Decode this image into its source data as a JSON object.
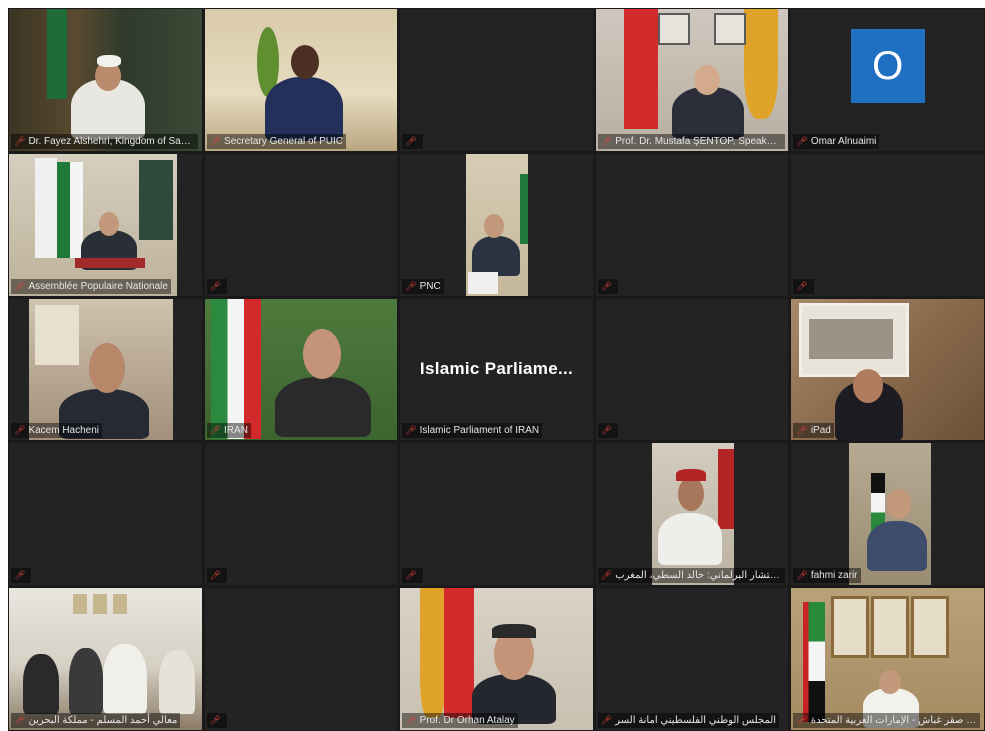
{
  "meeting": {
    "participants": [
      {
        "name": "Dr. Fayez Alshehri, Kingdom of Saudi Ar...",
        "video": true
      },
      {
        "name": "Secretary General of PUIC",
        "video": true,
        "active": true
      },
      {
        "name": "",
        "video": false
      },
      {
        "name": "Prof. Dr. Mustafa ŞENTOP, Speaker of th...",
        "video": true
      },
      {
        "name": "Omar Alnuaimi",
        "video": false,
        "avatar_letter": "O"
      },
      {
        "name": "Assemblée Populaire Nationale",
        "video": true
      },
      {
        "name": "",
        "video": false
      },
      {
        "name": "PNC",
        "video": true
      },
      {
        "name": "",
        "video": false
      },
      {
        "name": "",
        "video": false
      },
      {
        "name": "Kacem Hacheni",
        "video": true
      },
      {
        "name": "IRAN",
        "video": true
      },
      {
        "name": "Islamic Parliament of IRAN",
        "video": false,
        "center_label": "Islamic  Parliame..."
      },
      {
        "name": "",
        "video": false
      },
      {
        "name": "iPad",
        "video": true
      },
      {
        "name": "",
        "video": false
      },
      {
        "name": "",
        "video": false
      },
      {
        "name": "",
        "video": false
      },
      {
        "name": "المستشار البرلماني: خالد السطي، المغرب",
        "video": true
      },
      {
        "name": "fahmi zarir",
        "video": true
      },
      {
        "name": "معالي أحمد المسلم - مملكة البحرين",
        "video": true,
        "active": true
      },
      {
        "name": "",
        "video": false
      },
      {
        "name": "Prof. Dr Orhan Atalay",
        "video": true
      },
      {
        "name": "المجلس الوطني الفلسطيني امانة السر",
        "video": false
      },
      {
        "name": "معالي صقر غباش - الإمارات العربية المتحدة",
        "video": true
      }
    ]
  },
  "colors": {
    "tile_bg": "#232323",
    "grid_bg": "#1a1a1a",
    "active_border": "#d8d86a",
    "mic_muted": "#e0433e",
    "avatar_bg": "#1f6fc2"
  }
}
